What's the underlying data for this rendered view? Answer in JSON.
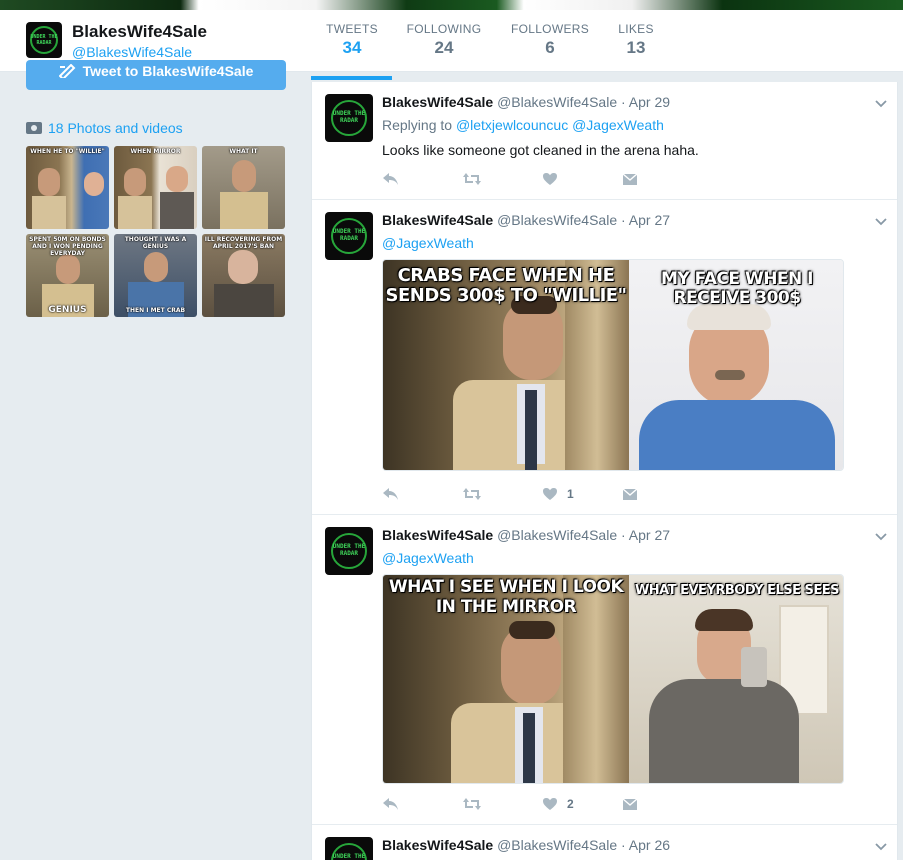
{
  "profile": {
    "name": "BlakesWife4Sale",
    "handle": "@BlakesWife4Sale",
    "avatar_text": "UNDER THE RADAR"
  },
  "stats": [
    {
      "label": "TWEETS",
      "value": "34",
      "active": true
    },
    {
      "label": "FOLLOWING",
      "value": "24"
    },
    {
      "label": "FOLLOWERS",
      "value": "6"
    },
    {
      "label": "LIKES",
      "value": "13"
    }
  ],
  "sidebar": {
    "tweet_to_button": "Tweet to BlakesWife4Sale",
    "photos_label": "18 Photos and videos",
    "thumbnails": [
      {
        "caption_top": "WHEN HE TO \"WILLIE\"",
        "caption_bottom": ""
      },
      {
        "caption_top": "WHEN MIRROR",
        "caption_bottom": ""
      },
      {
        "caption_top": "WHAT IT",
        "caption_bottom": ""
      },
      {
        "caption_top": "SPENT 50M ON BONDS AND I WON PENDING EVERYDAY",
        "caption_bottom": "GENIUS"
      },
      {
        "caption_top": "THOUGHT I WAS A GENIUS",
        "caption_bottom": "THEN I MET CRAB"
      },
      {
        "caption_top": "ILL RECOVERING FROM APRIL 2017'S BAN",
        "caption_bottom": ""
      }
    ]
  },
  "tweets": [
    {
      "name": "BlakesWife4Sale",
      "handle": "@BlakesWife4Sale",
      "date": "Apr 29",
      "replying_label": "Replying to",
      "replying_to": [
        "@letxjewlcouncuc",
        "@JagexWeath"
      ],
      "text": "Looks like someone got cleaned in the arena haha.",
      "likes": ""
    },
    {
      "name": "BlakesWife4Sale",
      "handle": "@BlakesWife4Sale",
      "date": "Apr 27",
      "mention": "@JagexWeath",
      "image": {
        "left_caption": "CRABS FACE WHEN HE SENDS 300$ TO \"WILLIE\"",
        "right_caption": "MY FACE WHEN I RECEIVE 300$"
      },
      "likes": "1"
    },
    {
      "name": "BlakesWife4Sale",
      "handle": "@BlakesWife4Sale",
      "date": "Apr 27",
      "mention": "@JagexWeath",
      "image": {
        "left_caption": "WHAT I SEE WHEN I LOOK IN THE MIRROR",
        "right_caption": "WHAT EVEYRBODY ELSE SEES"
      },
      "likes": "2"
    },
    {
      "name": "BlakesWife4Sale",
      "handle": "@BlakesWife4Sale",
      "date": "Apr 26"
    }
  ],
  "colors": {
    "accent": "#1da1f2",
    "muted": "#657786",
    "background": "#e6ecf0"
  }
}
